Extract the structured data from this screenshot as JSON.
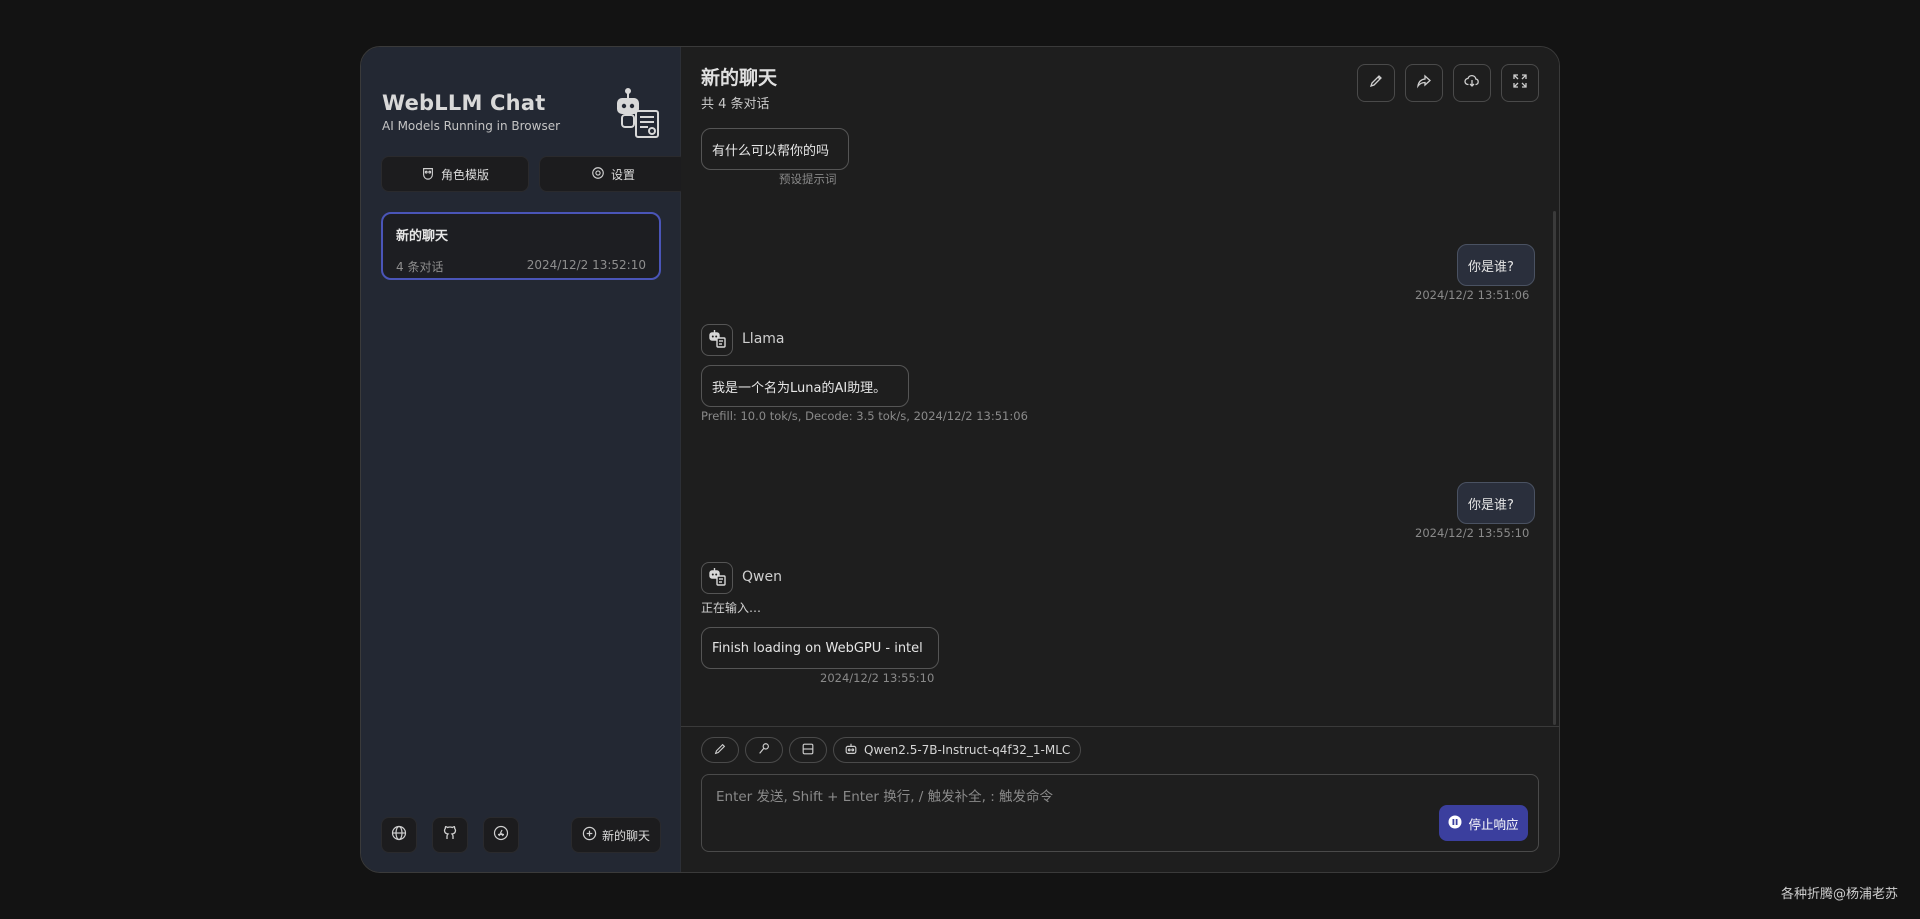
{
  "sidebar": {
    "app_title": "WebLLM Chat",
    "app_subtitle": "AI Models Running in Browser",
    "logo_icon": "robot-icon",
    "buttons": [
      {
        "label": "角色模版",
        "icon": "mask-icon"
      },
      {
        "label": "设置",
        "icon": "gear-icon"
      }
    ],
    "chats": [
      {
        "title": "新的聊天",
        "count": "4 条对话",
        "time": "2024/12/2 13:52:10",
        "selected": true
      }
    ],
    "footer": {
      "icons": [
        "globe-icon",
        "github-icon",
        "app-store-icon"
      ],
      "new_chat_label": "新的聊天"
    }
  },
  "main": {
    "title": "新的聊天",
    "subtitle": "共 4 条对话",
    "header_actions": [
      "edit-icon",
      "share-icon",
      "download-icon",
      "fullscreen-icon"
    ],
    "messages": {
      "preset": {
        "text": "有什么可以帮你的吗",
        "meta": "预设提示词"
      },
      "user1": {
        "text": "你是谁?",
        "time": "2024/12/2 13:51:06"
      },
      "bot1": {
        "model": "Llama",
        "text": "我是一个名为Luna的AI助理。",
        "meta": "Prefill: 10.0 tok/s,  Decode: 3.5 tok/s,  2024/12/2 13:51:06"
      },
      "user2": {
        "text": "你是谁?",
        "time": "2024/12/2 13:55:10"
      },
      "bot2": {
        "model": "Qwen",
        "typing": "正在输入…",
        "text": "Finish loading on WebGPU - intel",
        "time": "2024/12/2 13:55:10"
      }
    },
    "toolbar": {
      "icons": [
        "brush-icon",
        "prompt-icon",
        "layout-icon"
      ],
      "model_label": "Qwen2.5-7B-Instruct-q4f32_1-MLC"
    },
    "input": {
      "placeholder": "Enter 发送, Shift + Enter 换行, / 触发补全, : 触发命令",
      "value": ""
    },
    "stop_label": "停止响应"
  },
  "watermark": "各种折腾@杨浦老苏",
  "colors": {
    "accent": "#3b3f9e",
    "selected_border": "#4a55b8",
    "sidebar_bg": "#232833",
    "main_bg": "#1e1e1e",
    "page_bg": "#131313"
  }
}
